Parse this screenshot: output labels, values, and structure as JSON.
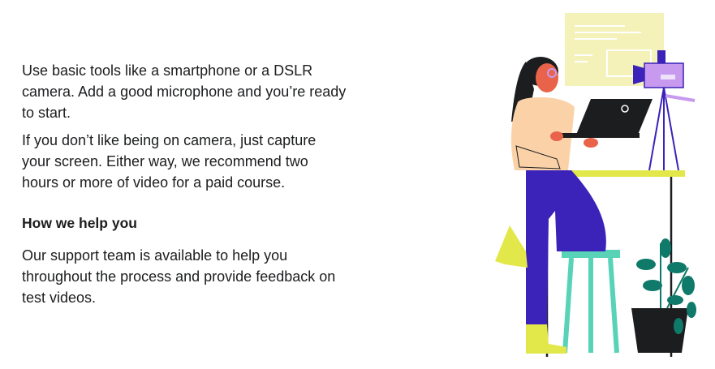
{
  "content": {
    "para1": "Use basic tools like a smartphone or a DSLR camera. Add a good microphone and you’re ready to start.",
    "para2": "If you don’t like being on camera, just capture your screen. Either way, we recommend two hours or more of video for a paid course.",
    "heading": "How we help you",
    "para3": "Our support team is available to help you throughout the process and provide feedback on test videos."
  },
  "colors": {
    "text": "#1c1d1f",
    "board": "#f4f2b8",
    "camera": "#c79af0",
    "pants": "#3b22b8",
    "shirt": "#fbd2a8",
    "desk": "#e3e84a",
    "stool": "#58d3b7",
    "plant": "#0f7a6a",
    "pot": "#1c1d1f",
    "skin": "#e9634a"
  },
  "illustration": {
    "icon": "content-creator-illustration"
  }
}
